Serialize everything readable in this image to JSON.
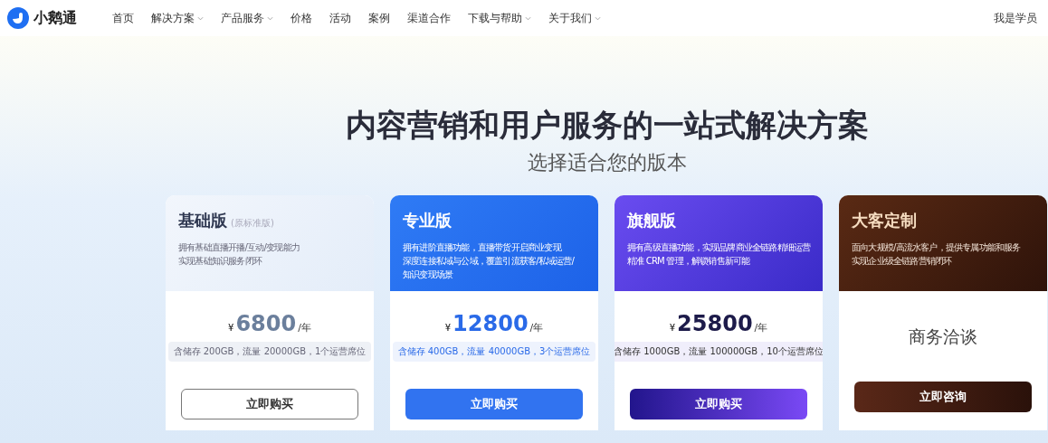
{
  "nav": {
    "brand": "小鹅通",
    "items": [
      {
        "label": "首页",
        "dropdown": false
      },
      {
        "label": "解决方案",
        "dropdown": true
      },
      {
        "label": "产品服务",
        "dropdown": true
      },
      {
        "label": "价格",
        "dropdown": false
      },
      {
        "label": "活动",
        "dropdown": false
      },
      {
        "label": "案例",
        "dropdown": false
      },
      {
        "label": "渠道合作",
        "dropdown": false
      },
      {
        "label": "下载与帮助",
        "dropdown": true
      },
      {
        "label": "关于我们",
        "dropdown": true
      }
    ],
    "account": "我是学员"
  },
  "hero": {
    "title": "内容营销和用户服务的一站式解决方案",
    "subtitle": "选择适合您的版本"
  },
  "plans": [
    {
      "kind": "basic",
      "name": "基础版",
      "note": "(原标准版)",
      "desc": [
        "拥有基础直播开播/互动/变现能力",
        "实现基础知识服务闭环"
      ],
      "currency": "¥",
      "price": "6800",
      "unit": "/年",
      "quota": "含储存 200GB，流量 20000GB，1个运营席位",
      "button": "立即购买"
    },
    {
      "kind": "pro",
      "name": "专业版",
      "desc": [
        "拥有进阶直播功能，直播带货开启商业变现",
        "深度连接私域与公域，覆盖引流获客/私域运营/",
        "知识变现场景"
      ],
      "currency": "¥",
      "price": "12800",
      "unit": "/年",
      "quota": "含储存 400GB，流量 40000GB，3个运营席位",
      "button": "立即购买"
    },
    {
      "kind": "flagship",
      "name": "旗舰版",
      "desc": [
        "拥有高级直播功能，实现品牌商业全链路精细运营",
        "精准 CRM 管理，解锁销售新可能"
      ],
      "currency": "¥",
      "price": "25800",
      "unit": "/年",
      "quota": "含储存 1000GB，流量 100000GB，10个运营席位",
      "button": "立即购买"
    },
    {
      "kind": "custom",
      "name": "大客定制",
      "desc": [
        "面向大规模/高流水客户，提供专属功能和服务",
        "实现企业级全链路营销闭环"
      ],
      "offer": "商务洽谈",
      "button": "立即咨询"
    }
  ]
}
